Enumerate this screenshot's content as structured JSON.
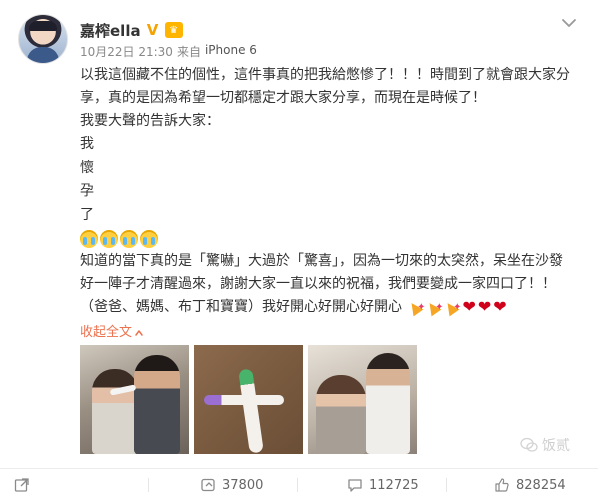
{
  "post": {
    "username": "嘉榨ella",
    "meta": {
      "time": "10月22日 21:30",
      "source_prefix": "来自",
      "device": "iPhone 6"
    },
    "content": {
      "lines": [
        "以我這個藏不住的個性，這件事真的把我給憋慘了！！！時間到了就會跟大家分",
        "享，真的是因為希望一切都穩定才跟大家分享，而現在是時候了！",
        "我要大聲的告訴大家："
      ],
      "chars": [
        "我",
        "懷",
        "孕",
        "了"
      ],
      "closing_lines": [
        "知道的當下真的是「驚嚇」大過於「驚喜」，因為一切來的太突然，呆坐在沙發",
        "好一陣子才清醒過來，謝謝大家一直以來的祝福，我們要變成一家四口了！！"
      ],
      "family_line": "（爸爸、媽媽、布丁和寶寶）我好開心好開心好開心",
      "collapse_label": "收起全文"
    },
    "actions": {
      "repost_count": "37800",
      "comment_count": "112725",
      "like_count": "828254"
    },
    "watermark": "饭贰"
  }
}
